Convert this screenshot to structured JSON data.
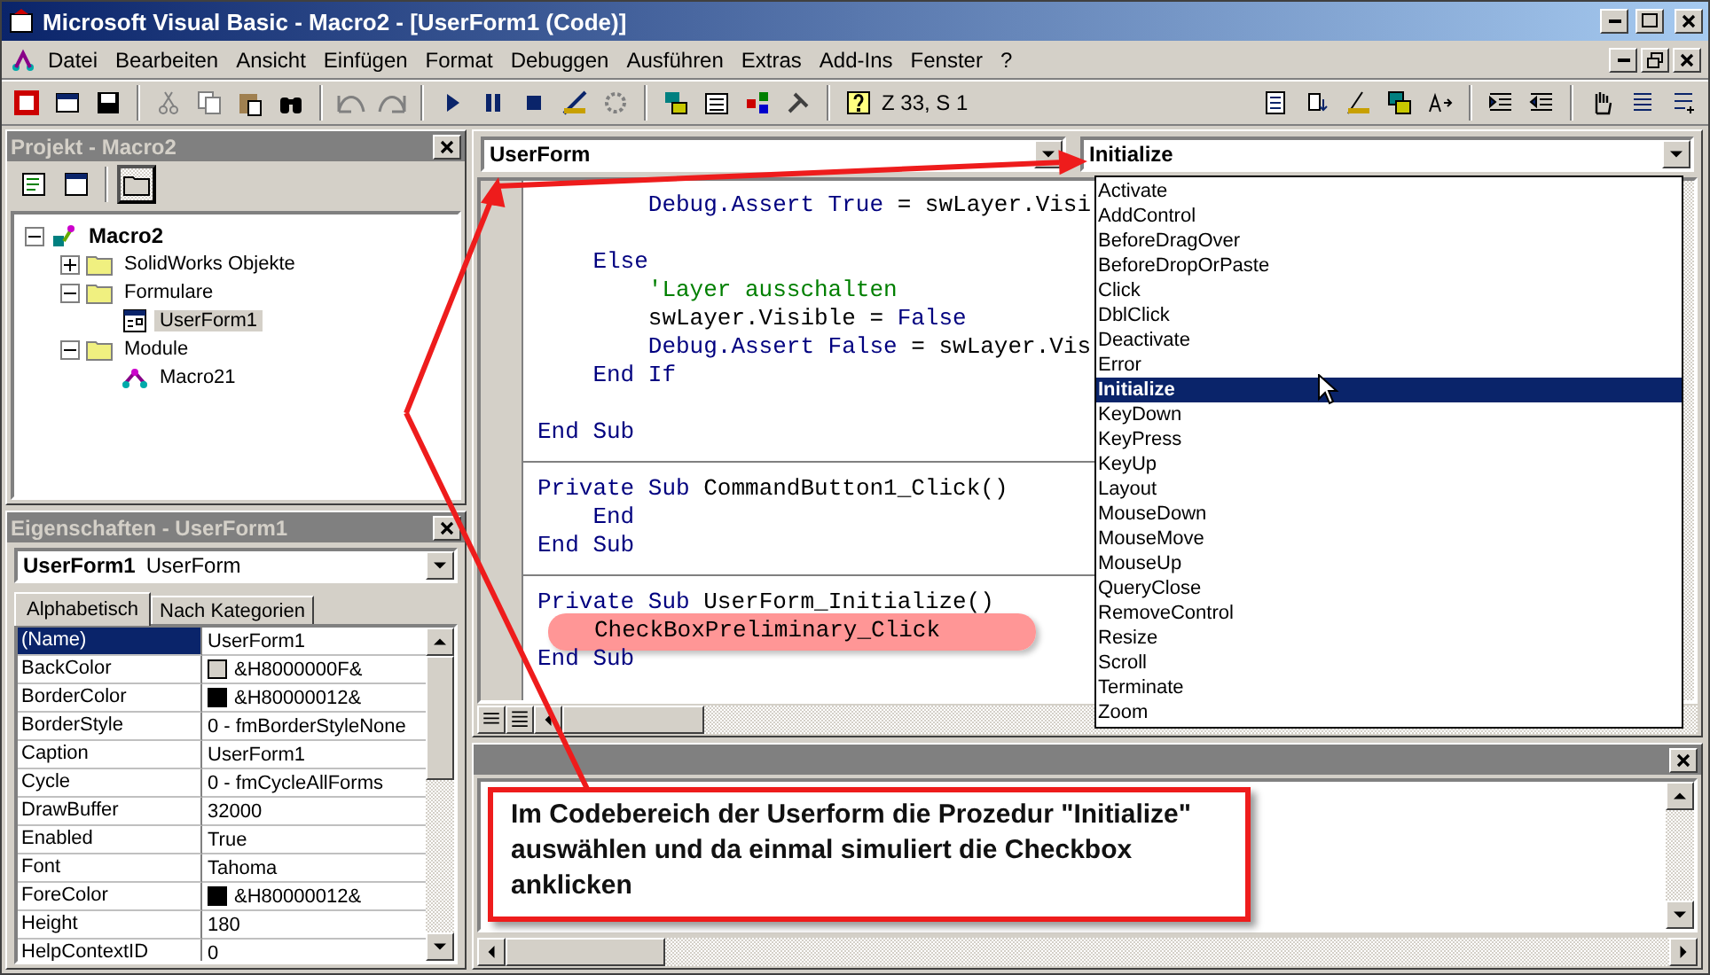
{
  "window": {
    "title": "Microsoft Visual Basic - Macro2 - [UserForm1 (Code)]"
  },
  "menu": [
    "Datei",
    "Bearbeiten",
    "Ansicht",
    "Einfügen",
    "Format",
    "Debuggen",
    "Ausführen",
    "Extras",
    "Add-Ins",
    "Fenster",
    "?"
  ],
  "toolbar": {
    "position": "Z 33, S 1"
  },
  "project": {
    "title": "Projekt - Macro2",
    "folders_pressed": true,
    "tree": [
      {
        "label": "Macro2",
        "kind": "project",
        "expanded": true,
        "selected": false,
        "children": [
          {
            "label": "SolidWorks Objekte",
            "kind": "folder",
            "expanded": false,
            "selected": false
          },
          {
            "label": "Formulare",
            "kind": "folder",
            "expanded": true,
            "selected": false,
            "children": [
              {
                "label": "UserForm1",
                "kind": "form",
                "selected": true
              }
            ]
          },
          {
            "label": "Module",
            "kind": "folder",
            "expanded": true,
            "selected": false,
            "children": [
              {
                "label": "Macro21",
                "kind": "module",
                "selected": false
              }
            ]
          }
        ]
      }
    ]
  },
  "properties": {
    "title": "Eigenschaften - UserForm1",
    "object": {
      "name": "UserForm1",
      "type": "UserForm"
    },
    "tabs": [
      {
        "label": "Alphabetisch",
        "selected": true
      },
      {
        "label": "Nach Kategorien",
        "selected": false
      }
    ],
    "rows": [
      {
        "name": "(Name)",
        "value": "UserForm1",
        "selected": true
      },
      {
        "name": "BackColor",
        "value": "&H8000000F&",
        "selected": false,
        "color": "#d4d0c8"
      },
      {
        "name": "BorderColor",
        "value": "&H80000012&",
        "selected": false,
        "color": "#000000"
      },
      {
        "name": "BorderStyle",
        "value": "0 - fmBorderStyleNone",
        "selected": false
      },
      {
        "name": "Caption",
        "value": "UserForm1",
        "selected": false
      },
      {
        "name": "Cycle",
        "value": "0 - fmCycleAllForms",
        "selected": false
      },
      {
        "name": "DrawBuffer",
        "value": "32000",
        "selected": false
      },
      {
        "name": "Enabled",
        "value": "True",
        "selected": false
      },
      {
        "name": "Font",
        "value": "Tahoma",
        "selected": false
      },
      {
        "name": "ForeColor",
        "value": "&H80000012&",
        "selected": false,
        "color": "#000000"
      },
      {
        "name": "Height",
        "value": "180",
        "selected": false
      },
      {
        "name": "HelpContextID",
        "value": "0",
        "selected": false
      }
    ]
  },
  "code": {
    "object": "UserForm",
    "procedure": "Initialize",
    "procedures": [
      {
        "label": "Activate",
        "selected": false
      },
      {
        "label": "AddControl",
        "selected": false
      },
      {
        "label": "BeforeDragOver",
        "selected": false
      },
      {
        "label": "BeforeDropOrPaste",
        "selected": false
      },
      {
        "label": "Click",
        "selected": false
      },
      {
        "label": "DblClick",
        "selected": false
      },
      {
        "label": "Deactivate",
        "selected": false
      },
      {
        "label": "Error",
        "selected": false
      },
      {
        "label": "Initialize",
        "selected": true
      },
      {
        "label": "KeyDown",
        "selected": false
      },
      {
        "label": "KeyPress",
        "selected": false
      },
      {
        "label": "KeyUp",
        "selected": false
      },
      {
        "label": "Layout",
        "selected": false
      },
      {
        "label": "MouseDown",
        "selected": false
      },
      {
        "label": "MouseMove",
        "selected": false
      },
      {
        "label": "MouseUp",
        "selected": false
      },
      {
        "label": "QueryClose",
        "selected": false
      },
      {
        "label": "RemoveControl",
        "selected": false
      },
      {
        "label": "Resize",
        "selected": false
      },
      {
        "label": "Scroll",
        "selected": false
      },
      {
        "label": "Terminate",
        "selected": false
      },
      {
        "label": "Zoom",
        "selected": false
      }
    ],
    "sections": [
      {
        "groups": [
          {
            "lines": [
              {
                "segments": [
                  {
                    "kind": "keyword",
                    "text": "        Debug.Assert True"
                  },
                  {
                    "kind": "plain",
                    "text": " = swLayer.Visi"
                  }
                ]
              }
            ]
          },
          {
            "lines": [
              {
                "segments": [
                  {
                    "kind": "keyword",
                    "text": "    Else"
                  }
                ]
              },
              {
                "segments": [
                  {
                    "kind": "comment",
                    "text": "        'Layer ausschalten"
                  }
                ]
              },
              {
                "segments": [
                  {
                    "kind": "plain",
                    "text": "        swLayer.Visible = "
                  },
                  {
                    "kind": "keyword",
                    "text": "False"
                  }
                ]
              },
              {
                "segments": [
                  {
                    "kind": "keyword",
                    "text": "        Debug.Assert False"
                  },
                  {
                    "kind": "plain",
                    "text": " = swLayer.Vis"
                  }
                ]
              },
              {
                "segments": [
                  {
                    "kind": "keyword",
                    "text": "    End If"
                  }
                ]
              }
            ]
          },
          {
            "lines": [
              {
                "segments": [
                  {
                    "kind": "keyword",
                    "text": "End Sub"
                  }
                ]
              }
            ]
          }
        ]
      },
      {
        "groups": [
          {
            "lines": [
              {
                "segments": [
                  {
                    "kind": "keyword",
                    "text": "Private Sub"
                  },
                  {
                    "kind": "plain",
                    "text": " CommandButton1_Click()"
                  }
                ]
              },
              {
                "segments": [
                  {
                    "kind": "keyword",
                    "text": "    End"
                  }
                ]
              },
              {
                "segments": [
                  {
                    "kind": "keyword",
                    "text": "End Sub"
                  }
                ]
              }
            ]
          }
        ]
      },
      {
        "groups": [
          {
            "lines": [
              {
                "segments": [
                  {
                    "kind": "keyword",
                    "text": "Private Sub"
                  },
                  {
                    "kind": "plain",
                    "text": " UserForm_Initialize()"
                  }
                ]
              },
              {
                "segments": [
                  {
                    "kind": "marked",
                    "text": "CheckBoxPreliminary_Click"
                  }
                ]
              },
              {
                "segments": [
                  {
                    "kind": "keyword",
                    "text": "End Sub"
                  }
                ]
              }
            ]
          }
        ]
      }
    ]
  },
  "callout": {
    "text": "Im Codebereich der Userform die Prozedur \"Initialize\" auswählen und da einmal simuliert die Checkbox anklicken"
  }
}
